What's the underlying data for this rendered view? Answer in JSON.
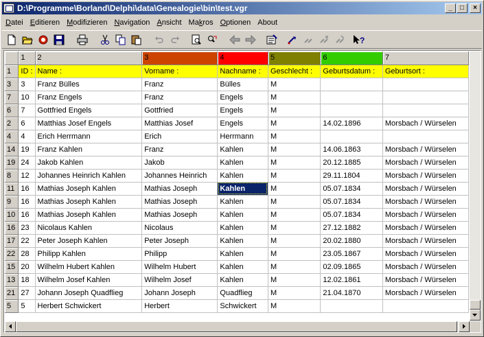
{
  "window": {
    "title": "D:\\Programme\\Borland\\Delphi\\data\\Genealogie\\bin\\test.vgr",
    "minimize": "_",
    "maximize": "□",
    "close": "×"
  },
  "menu": [
    "Datei",
    "Editieren",
    "Modifizieren",
    "Navigation",
    "Ansicht",
    "Makros",
    "Optionen",
    "About"
  ],
  "menu_underline": [
    "D",
    "E",
    "M",
    "N",
    "A",
    "k",
    "O",
    ""
  ],
  "toolbar": {
    "icons": [
      "new-file-icon",
      "open-folder-icon",
      "revert-icon",
      "save-icon",
      "print-icon",
      "cut-icon",
      "copy-icon",
      "paste-icon",
      "undo-icon",
      "redo-icon",
      "find-icon",
      "find-replace-icon",
      "back-arrow-icon",
      "forward-arrow-icon",
      "properties-icon",
      "macro-icon",
      "macro-disabled-1-icon",
      "macro-disabled-2-icon",
      "macro-disabled-3-icon",
      "help-pointer-icon"
    ]
  },
  "grid": {
    "column_numbers": [
      "1",
      "2",
      "3",
      "4",
      "5",
      "6",
      "7"
    ],
    "column_colors": [
      "#d4d0c8",
      "#d4d0c8",
      "#cc4400",
      "#ff0000",
      "#808000",
      "#33cc00",
      "#d4d0c8"
    ],
    "headers": [
      "ID :",
      "Name :",
      "Vorname :",
      "Nachname :",
      "Geschlecht :",
      "Geburtsdatum :",
      "Geburtsort :"
    ],
    "header_row_number": "1",
    "rows": [
      {
        "row": "3",
        "cells": [
          "3",
          "Franz Bülles",
          "Franz",
          "Bülles",
          "M",
          "",
          ""
        ]
      },
      {
        "row": "7",
        "cells": [
          "10",
          "Franz Engels",
          "Franz",
          "Engels",
          "M",
          "",
          ""
        ]
      },
      {
        "row": "6",
        "cells": [
          "7",
          "Gottfried Engels",
          "Gottfried",
          "Engels",
          "M",
          "",
          ""
        ]
      },
      {
        "row": "2",
        "cells": [
          "6",
          "Matthias Josef Engels",
          "Matthias Josef",
          "Engels",
          "M",
          "14.02.1896",
          "Morsbach / Würselen"
        ]
      },
      {
        "row": "4",
        "cells": [
          "4",
          "Erich Herrmann",
          "Erich",
          "Herrmann",
          "M",
          "",
          ""
        ]
      },
      {
        "row": "14",
        "cells": [
          "19",
          "Franz Kahlen",
          "Franz",
          "Kahlen",
          "M",
          "14.06.1863",
          "Morsbach / Würselen"
        ]
      },
      {
        "row": "19",
        "cells": [
          "24",
          "Jakob Kahlen",
          "Jakob",
          "Kahlen",
          "M",
          "20.12.1885",
          "Morsbach / Würselen"
        ]
      },
      {
        "row": "8",
        "cells": [
          "12",
          "Johannes Heinrich Kahlen",
          "Johannes Heinrich",
          "Kahlen",
          "M",
          "29.11.1804",
          "Morsbach / Würselen"
        ]
      },
      {
        "row": "11",
        "cells": [
          "16",
          "Mathias Joseph Kahlen",
          "Mathias Joseph",
          "Kahlen",
          "M",
          "05.07.1834",
          "Morsbach / Würselen"
        ],
        "selected": 3
      },
      {
        "row": "9",
        "cells": [
          "16",
          "Mathias Joseph Kahlen",
          "Mathias Joseph",
          "Kahlen",
          "M",
          "05.07.1834",
          "Morsbach / Würselen"
        ]
      },
      {
        "row": "10",
        "cells": [
          "16",
          "Mathias Joseph Kahlen",
          "Mathias Joseph",
          "Kahlen",
          "M",
          "05.07.1834",
          "Morsbach / Würselen"
        ]
      },
      {
        "row": "16",
        "cells": [
          "23",
          "Nicolaus Kahlen",
          "Nicolaus",
          "Kahlen",
          "M",
          "27.12.1882",
          "Morsbach / Würselen"
        ]
      },
      {
        "row": "17",
        "cells": [
          "22",
          "Peter Joseph Kahlen",
          "Peter Joseph",
          "Kahlen",
          "M",
          "20.02.1880",
          "Morsbach / Würselen"
        ]
      },
      {
        "row": "22",
        "cells": [
          "28",
          "Philipp Kahlen",
          "Philipp",
          "Kahlen",
          "M",
          "23.05.1867",
          "Morsbach / Würselen"
        ]
      },
      {
        "row": "15",
        "cells": [
          "20",
          "Wilhelm Hubert Kahlen",
          "Wilhelm Hubert",
          "Kahlen",
          "M",
          "02.09.1865",
          "Morsbach / Würselen"
        ]
      },
      {
        "row": "13",
        "cells": [
          "18",
          "Wilhelm Josef Kahlen",
          "Wilhelm Josef",
          "Kahlen",
          "M",
          "12.02.1861",
          "Morsbach / Würselen"
        ]
      },
      {
        "row": "21",
        "cells": [
          "27",
          "Johann Joseph Quadflieg",
          "Johann Joseph",
          "Quadflieg",
          "M",
          "21.04.1870",
          "Morsbach / Würselen"
        ]
      },
      {
        "row": "5",
        "cells": [
          "5",
          "Herbert Schwickert",
          "Herbert",
          "Schwickert",
          "M",
          "",
          ""
        ]
      }
    ]
  }
}
